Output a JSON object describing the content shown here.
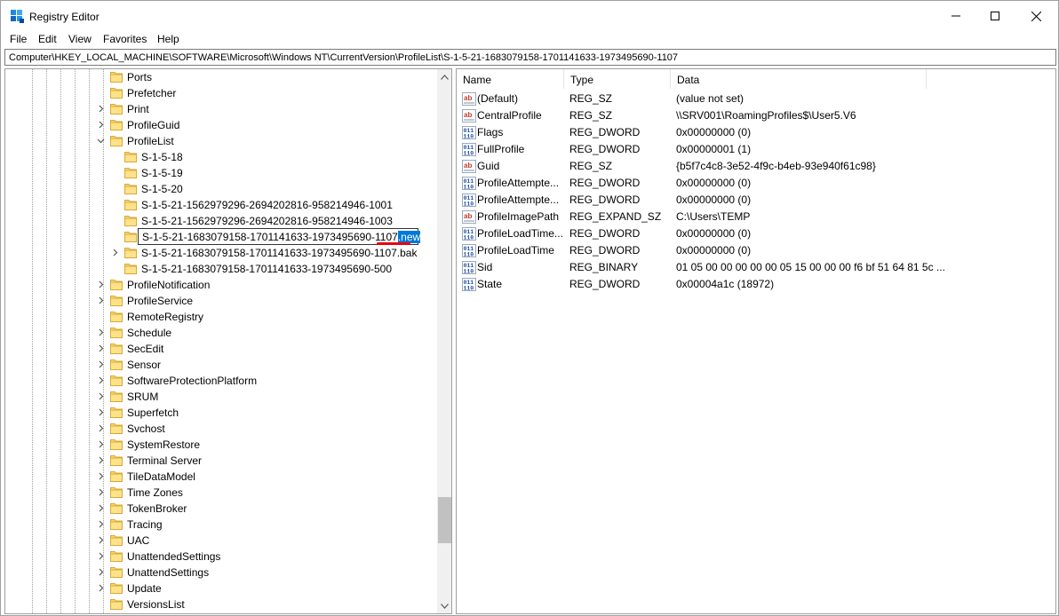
{
  "window": {
    "title": "Registry Editor",
    "accent": "#0078d7"
  },
  "menu": [
    "File",
    "Edit",
    "View",
    "Favorites",
    "Help"
  ],
  "address": "Computer\\HKEY_LOCAL_MACHINE\\SOFTWARE\\Microsoft\\Windows NT\\CurrentVersion\\ProfileList\\S-1-5-21-1683079158-1701141633-1973495690-1107",
  "tree": {
    "items": [
      {
        "label": "Ports",
        "level": 1,
        "expander": "none"
      },
      {
        "label": "Prefetcher",
        "level": 1,
        "expander": "none"
      },
      {
        "label": "Print",
        "level": 1,
        "expander": "collapsed"
      },
      {
        "label": "ProfileGuid",
        "level": 1,
        "expander": "collapsed"
      },
      {
        "label": "ProfileList",
        "level": 1,
        "expander": "expanded"
      },
      {
        "label": "S-1-5-18",
        "level": 2,
        "expander": "none"
      },
      {
        "label": "S-1-5-19",
        "level": 2,
        "expander": "none"
      },
      {
        "label": "S-1-5-20",
        "level": 2,
        "expander": "none"
      },
      {
        "label": "S-1-5-21-1562979296-2694202816-958214946-1001",
        "level": 2,
        "expander": "none"
      },
      {
        "label": "S-1-5-21-1562979296-2694202816-958214946-1003",
        "level": 2,
        "expander": "none"
      },
      {
        "label": "",
        "level": 2,
        "expander": "none",
        "editing": true
      },
      {
        "label": "S-1-5-21-1683079158-1701141633-1973495690-1107.bak",
        "level": 2,
        "expander": "collapsed"
      },
      {
        "label": "S-1-5-21-1683079158-1701141633-1973495690-500",
        "level": 2,
        "expander": "none"
      },
      {
        "label": "ProfileNotification",
        "level": 1,
        "expander": "collapsed"
      },
      {
        "label": "ProfileService",
        "level": 1,
        "expander": "collapsed"
      },
      {
        "label": "RemoteRegistry",
        "level": 1,
        "expander": "none"
      },
      {
        "label": "Schedule",
        "level": 1,
        "expander": "collapsed"
      },
      {
        "label": "SecEdit",
        "level": 1,
        "expander": "collapsed"
      },
      {
        "label": "Sensor",
        "level": 1,
        "expander": "collapsed"
      },
      {
        "label": "SoftwareProtectionPlatform",
        "level": 1,
        "expander": "collapsed"
      },
      {
        "label": "SRUM",
        "level": 1,
        "expander": "collapsed"
      },
      {
        "label": "Superfetch",
        "level": 1,
        "expander": "collapsed"
      },
      {
        "label": "Svchost",
        "level": 1,
        "expander": "collapsed"
      },
      {
        "label": "SystemRestore",
        "level": 1,
        "expander": "collapsed"
      },
      {
        "label": "Terminal Server",
        "level": 1,
        "expander": "collapsed"
      },
      {
        "label": "TileDataModel",
        "level": 1,
        "expander": "collapsed"
      },
      {
        "label": "Time Zones",
        "level": 1,
        "expander": "collapsed"
      },
      {
        "label": "TokenBroker",
        "level": 1,
        "expander": "collapsed"
      },
      {
        "label": "Tracing",
        "level": 1,
        "expander": "collapsed"
      },
      {
        "label": "UAC",
        "level": 1,
        "expander": "collapsed"
      },
      {
        "label": "UnattendedSettings",
        "level": 1,
        "expander": "collapsed"
      },
      {
        "label": "UnattendSettings",
        "level": 1,
        "expander": "collapsed"
      },
      {
        "label": "Update",
        "level": 1,
        "expander": "collapsed"
      },
      {
        "label": "VersionsList",
        "level": 1,
        "expander": "none"
      }
    ],
    "rename": {
      "prefix": "S-1-5-21-1683079158-1701141633-1973495690-1107",
      "selected": ".new"
    }
  },
  "list": {
    "columns": [
      "Name",
      "Type",
      "Data"
    ],
    "rows": [
      {
        "icon": "string-value-icon",
        "name": "(Default)",
        "type": "REG_SZ",
        "data": "(value not set)"
      },
      {
        "icon": "string-value-icon",
        "name": "CentralProfile",
        "type": "REG_SZ",
        "data": "\\\\SRV001\\RoamingProfiles$\\User5.V6"
      },
      {
        "icon": "binary-value-icon",
        "name": "Flags",
        "type": "REG_DWORD",
        "data": "0x00000000 (0)"
      },
      {
        "icon": "binary-value-icon",
        "name": "FullProfile",
        "type": "REG_DWORD",
        "data": "0x00000001 (1)"
      },
      {
        "icon": "string-value-icon",
        "name": "Guid",
        "type": "REG_SZ",
        "data": "{b5f7c4c8-3e52-4f9c-b4eb-93e940f61c98}"
      },
      {
        "icon": "binary-value-icon",
        "name": "ProfileAttempte...",
        "type": "REG_DWORD",
        "data": "0x00000000 (0)"
      },
      {
        "icon": "binary-value-icon",
        "name": "ProfileAttempte...",
        "type": "REG_DWORD",
        "data": "0x00000000 (0)"
      },
      {
        "icon": "string-value-icon",
        "name": "ProfileImagePath",
        "type": "REG_EXPAND_SZ",
        "data": "C:\\Users\\TEMP"
      },
      {
        "icon": "binary-value-icon",
        "name": "ProfileLoadTime...",
        "type": "REG_DWORD",
        "data": "0x00000000 (0)"
      },
      {
        "icon": "binary-value-icon",
        "name": "ProfileLoadTime",
        "type": "REG_DWORD",
        "data": "0x00000000 (0)"
      },
      {
        "icon": "binary-value-icon",
        "name": "Sid",
        "type": "REG_BINARY",
        "data": "01 05 00 00 00 00 00 05 15 00 00 00 f6 bf 51 64 81 5c ..."
      },
      {
        "icon": "binary-value-icon",
        "name": "State",
        "type": "REG_DWORD",
        "data": "0x00004a1c (18972)"
      }
    ]
  }
}
